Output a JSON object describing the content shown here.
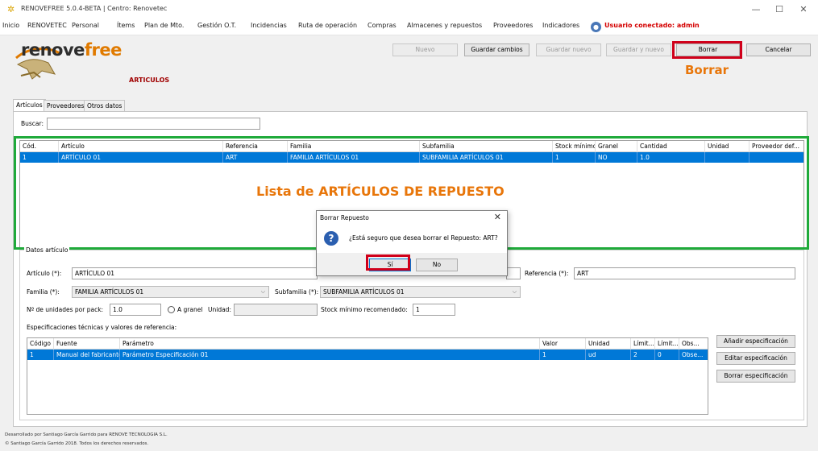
{
  "window": {
    "title": "RENOVEFREE 5.0.4-BETA | Centro: Renovetec",
    "controls": {
      "minimize": "—",
      "maximize": "☐",
      "close": "✕"
    }
  },
  "menu": {
    "items": [
      "Inicio",
      "RENOVETEC",
      "Personal",
      "Ítems",
      "Plan de Mto.",
      "Gestión O.T.",
      "Incidencias",
      "Ruta de operación",
      "Compras",
      "Almacenes y repuestos",
      "Proveedores",
      "Indicadores"
    ],
    "user_label": "Usuario conectado: admin"
  },
  "brand": {
    "logo_part1": "renove",
    "logo_part2": "free",
    "form_title": "ARTICULOS"
  },
  "toolbar": {
    "nuevo": "Nuevo",
    "guardar_cambios": "Guardar cambios",
    "guardar_nuevo": "Guardar nuevo",
    "guardar_y_nuevo": "Guardar y nuevo",
    "borrar": "Borrar",
    "cancelar": "Cancelar"
  },
  "annotations": {
    "borrar": "Borrar",
    "lista": "Lista de ARTÍCULOS DE REPUESTO"
  },
  "tabs": [
    "Artículos",
    "Proveedores",
    "Otros datos"
  ],
  "search": {
    "label": "Buscar:",
    "value": ""
  },
  "articles_table": {
    "columns": [
      "Cód.",
      "Artículo",
      "Referencia",
      "Familia",
      "Subfamilia",
      "Stock mínimo",
      "Granel",
      "Cantidad",
      "Unidad",
      "Proveedor def..."
    ],
    "rows": [
      [
        "1",
        "ARTÍCULO 01",
        "ART",
        "FAMILIA ARTÍCULOS 01",
        "SUBFAMILIA ARTÍCULOS 01",
        "1",
        "NO",
        "1.0",
        "",
        ""
      ]
    ]
  },
  "details": {
    "group_title": "Datos artículo",
    "articulo_label": "Artículo (*):",
    "articulo_value": "ARTÍCULO 01",
    "referencia_label": "Referencia (*):",
    "referencia_value": "ART",
    "familia_label": "Familia (*):",
    "familia_value": "FAMILIA ARTÍCULOS 01",
    "subfamilia_label": "Subfamilia (*):",
    "subfamilia_value": "SUBFAMILIA ARTÍCULOS 01",
    "pack_label": "Nº de unidades por pack:",
    "pack_value": "1.0",
    "granel_label": "A granel",
    "unidad_label": "Unidad:",
    "unidad_value": "",
    "stock_label": "Stock mínimo recomendado:",
    "stock_value": "1",
    "specs_label": "Especificaciones técnicas y valores de referencia:"
  },
  "specs_table": {
    "columns": [
      "Código",
      "Fuente",
      "Parámetro",
      "Valor",
      "Unidad",
      "Límit...",
      "Límit...",
      "Obs..."
    ],
    "rows": [
      [
        "1",
        "Manual del fabricante",
        "Parámetro Especificación 01",
        "1",
        "ud",
        "2",
        "0",
        "Obse..."
      ]
    ]
  },
  "spec_buttons": {
    "add": "Añadir especificación",
    "edit": "Editar especificación",
    "delete": "Borrar especificación"
  },
  "footer": {
    "line1": "Desarrollado por Santiago García Garrido para RENOVE TECNOLOGIA S.L.",
    "line2": "© Santiago García Garrido 2018. Todos los derechos reservados."
  },
  "dialog": {
    "title": "Borrar Repuesto",
    "close": "✕",
    "message": "¿Está seguro que desea borrar el Repuesto: ART?",
    "yes": "Sí",
    "no": "No"
  },
  "colors": {
    "selection": "#0078d7",
    "annotation": "#e8760a",
    "highlight_red": "#d0001a",
    "highlight_green": "#1faa3a"
  }
}
